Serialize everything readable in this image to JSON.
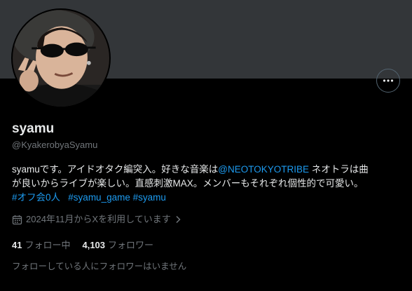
{
  "profile": {
    "display_name": "syamu",
    "handle": "@KyakerobyaSyamu",
    "bio": {
      "part1": "syamuです。アイドオタク編突入。好きな音楽は",
      "mention": "@NEOTOKYOTRIBE",
      "part2": " ネオトラは曲",
      "line2": "が良いからライブが楽しい。直感刺激MAX。メンバーもそれぞれ個性的で可愛い。",
      "hashtag1": "#オフ会0人",
      "hashtag2": "#syamu_game",
      "hashtag3": "#syamu"
    },
    "joined": "2024年11月からXを利用しています",
    "following_count": "41",
    "following_label": "フォロー中",
    "followers_count": "4,103",
    "followers_label": "フォロワー",
    "no_followers_you_know": "フォローしている人にフォロワーはいません"
  },
  "icons": {
    "more": "more-horizontal-icon",
    "calendar": "calendar-icon",
    "chevron": "chevron-right-icon"
  },
  "colors": {
    "background": "#000000",
    "banner": "#333639",
    "link": "#1d9bf0",
    "primary_text": "#e7e9ea",
    "secondary_text": "#71767b"
  }
}
